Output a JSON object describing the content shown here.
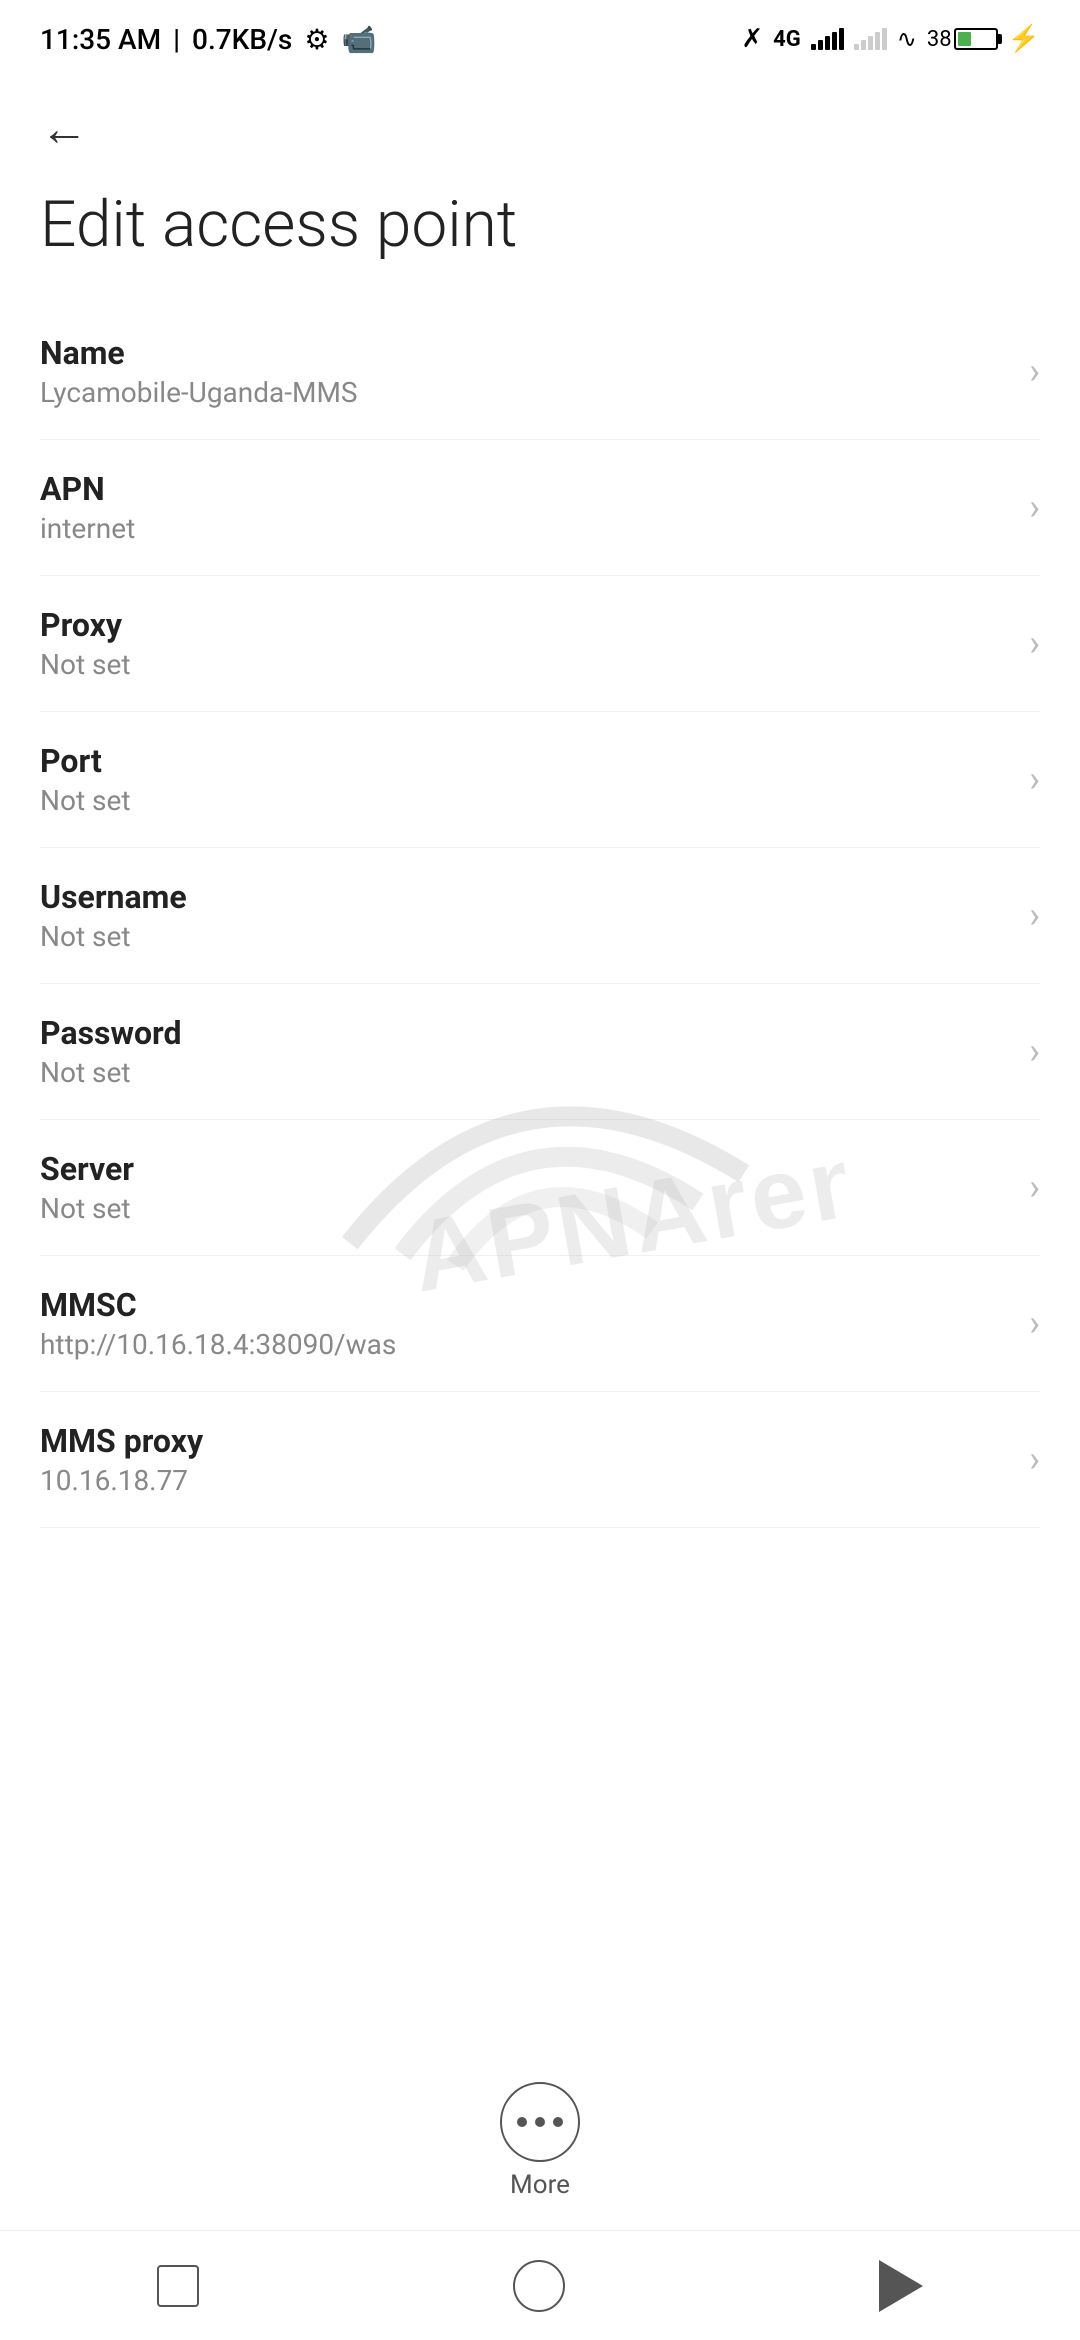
{
  "statusBar": {
    "time": "11:35 AM",
    "dataSpeed": "0.7KB/s",
    "battery": "38",
    "batteryPercent": 38
  },
  "header": {
    "backLabel": "←",
    "title": "Edit access point"
  },
  "settings": {
    "items": [
      {
        "label": "Name",
        "value": "Lycamobile-Uganda-MMS"
      },
      {
        "label": "APN",
        "value": "internet"
      },
      {
        "label": "Proxy",
        "value": "Not set"
      },
      {
        "label": "Port",
        "value": "Not set"
      },
      {
        "label": "Username",
        "value": "Not set"
      },
      {
        "label": "Password",
        "value": "Not set"
      },
      {
        "label": "Server",
        "value": "Not set"
      },
      {
        "label": "MMSC",
        "value": "http://10.16.18.4:38090/was"
      },
      {
        "label": "MMS proxy",
        "value": "10.16.18.77"
      }
    ]
  },
  "moreButton": {
    "label": "More"
  },
  "watermark": "APNArena"
}
